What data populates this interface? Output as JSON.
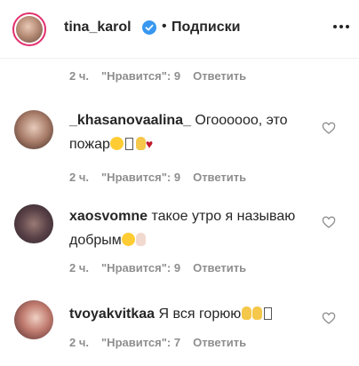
{
  "header": {
    "username": "tina_karol",
    "separator": "•",
    "follow_label": "Подписки"
  },
  "top_meta": {
    "time": "2 ч.",
    "likes": "\"Нравится\": 9",
    "reply": "Ответить"
  },
  "comments": [
    {
      "user": "_khasanovaalina_",
      "text": "Огоооооо, это пожар",
      "time": "2 ч.",
      "likes": "\"Нравится\": 9",
      "reply": "Ответить"
    },
    {
      "user": "xaosvomne",
      "text": "такое утро я называю добрым",
      "time": "2 ч.",
      "likes": "\"Нравится\": 9",
      "reply": "Ответить"
    },
    {
      "user": "tvoyakvitkaa",
      "text": "Я вся горюю",
      "time": "2 ч.",
      "likes": "\"Нравится\": 7",
      "reply": "Ответить"
    }
  ],
  "colors": {
    "verified": "#3897f0",
    "muted": "#8e8e8e",
    "text": "#262626",
    "story_ring": "#e1306c"
  }
}
